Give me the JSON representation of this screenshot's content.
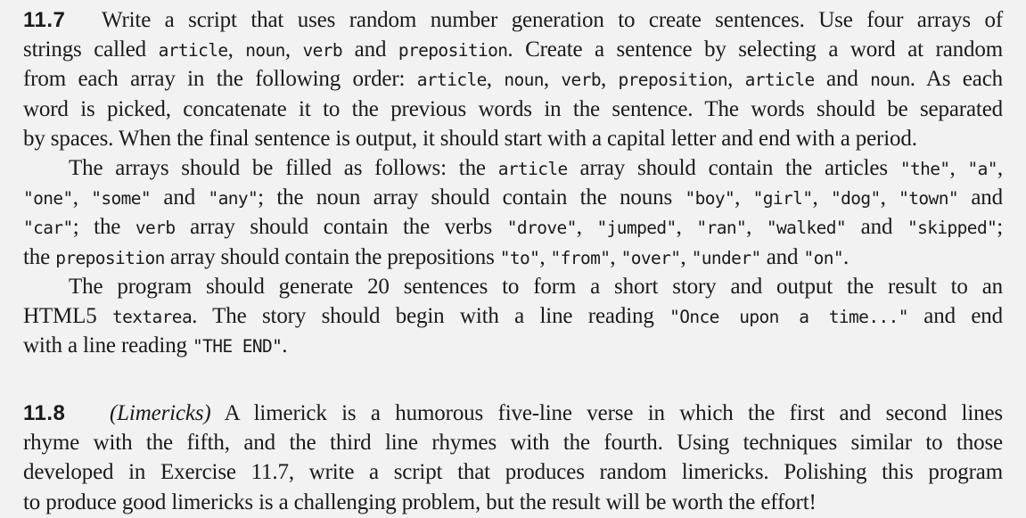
{
  "exercises": [
    {
      "number": "11.7",
      "lines": [
        {
          "indent": false,
          "last": false,
          "segments": [
            {
              "t": "num",
              "v": "11.7"
            },
            {
              "t": "text",
              "v": "Write a script that uses random number generation to create sentences. Use four arrays of"
            }
          ]
        },
        {
          "indent": false,
          "last": false,
          "segments": [
            {
              "t": "text",
              "v": "strings called "
            },
            {
              "t": "code",
              "v": "article"
            },
            {
              "t": "text",
              "v": ", "
            },
            {
              "t": "code",
              "v": "noun"
            },
            {
              "t": "text",
              "v": ", "
            },
            {
              "t": "code",
              "v": "verb"
            },
            {
              "t": "text",
              "v": " and "
            },
            {
              "t": "code",
              "v": "preposition"
            },
            {
              "t": "text",
              "v": ". Create a sentence by selecting a word at random"
            }
          ]
        },
        {
          "indent": false,
          "last": false,
          "segments": [
            {
              "t": "text",
              "v": "from each array in the following order: "
            },
            {
              "t": "code",
              "v": "article"
            },
            {
              "t": "text",
              "v": ", "
            },
            {
              "t": "code",
              "v": "noun"
            },
            {
              "t": "text",
              "v": ", "
            },
            {
              "t": "code",
              "v": "verb"
            },
            {
              "t": "text",
              "v": ", "
            },
            {
              "t": "code",
              "v": "preposition"
            },
            {
              "t": "text",
              "v": ", "
            },
            {
              "t": "code",
              "v": "article"
            },
            {
              "t": "text",
              "v": " and "
            },
            {
              "t": "code",
              "v": "noun"
            },
            {
              "t": "text",
              "v": ". As each"
            }
          ]
        },
        {
          "indent": false,
          "last": false,
          "segments": [
            {
              "t": "text",
              "v": "word is picked, concatenate it to the previous words in the sentence. The words should be separated"
            }
          ]
        },
        {
          "indent": false,
          "last": true,
          "segments": [
            {
              "t": "text",
              "v": "by spaces. When the final sentence is output, it should start with a capital letter and end with a period."
            }
          ]
        },
        {
          "indent": true,
          "last": false,
          "segments": [
            {
              "t": "text",
              "v": "The arrays should be filled as follows: the "
            },
            {
              "t": "code",
              "v": "article"
            },
            {
              "t": "text",
              "v": " array should contain the articles "
            },
            {
              "t": "code",
              "v": "\"the\""
            },
            {
              "t": "text",
              "v": ", "
            },
            {
              "t": "code",
              "v": "\"a\""
            },
            {
              "t": "text",
              "v": ","
            }
          ]
        },
        {
          "indent": false,
          "last": false,
          "segments": [
            {
              "t": "code",
              "v": "\"one\""
            },
            {
              "t": "text",
              "v": ", "
            },
            {
              "t": "code",
              "v": "\"some\""
            },
            {
              "t": "text",
              "v": " and "
            },
            {
              "t": "code",
              "v": "\"any\""
            },
            {
              "t": "text",
              "v": "; the noun array should contain the nouns "
            },
            {
              "t": "code",
              "v": "\"boy\""
            },
            {
              "t": "text",
              "v": ", "
            },
            {
              "t": "code",
              "v": "\"girl\""
            },
            {
              "t": "text",
              "v": ", "
            },
            {
              "t": "code",
              "v": "\"dog\""
            },
            {
              "t": "text",
              "v": ", "
            },
            {
              "t": "code",
              "v": "\"town\""
            },
            {
              "t": "text",
              "v": " and"
            }
          ]
        },
        {
          "indent": false,
          "last": false,
          "segments": [
            {
              "t": "code",
              "v": "\"car\""
            },
            {
              "t": "text",
              "v": "; the "
            },
            {
              "t": "code",
              "v": "verb"
            },
            {
              "t": "text",
              "v": " array should contain the verbs "
            },
            {
              "t": "code",
              "v": "\"drove\""
            },
            {
              "t": "text",
              "v": ", "
            },
            {
              "t": "code",
              "v": "\"jumped\""
            },
            {
              "t": "text",
              "v": ", "
            },
            {
              "t": "code",
              "v": "\"ran\""
            },
            {
              "t": "text",
              "v": ", "
            },
            {
              "t": "code",
              "v": "\"walked\""
            },
            {
              "t": "text",
              "v": " and "
            },
            {
              "t": "code",
              "v": "\"skipped\""
            },
            {
              "t": "text",
              "v": ";"
            }
          ]
        },
        {
          "indent": false,
          "last": true,
          "segments": [
            {
              "t": "text",
              "v": "the "
            },
            {
              "t": "code",
              "v": "preposition"
            },
            {
              "t": "text",
              "v": " array should contain the prepositions "
            },
            {
              "t": "code",
              "v": "\"to\""
            },
            {
              "t": "text",
              "v": ", "
            },
            {
              "t": "code",
              "v": "\"from\""
            },
            {
              "t": "text",
              "v": ", "
            },
            {
              "t": "code",
              "v": "\"over\""
            },
            {
              "t": "text",
              "v": ", "
            },
            {
              "t": "code",
              "v": "\"under\""
            },
            {
              "t": "text",
              "v": " and "
            },
            {
              "t": "code",
              "v": "\"on\""
            },
            {
              "t": "text",
              "v": "."
            }
          ]
        },
        {
          "indent": true,
          "last": false,
          "segments": [
            {
              "t": "text",
              "v": "The program should generate 20 sentences to form a short story and output the result to an"
            }
          ]
        },
        {
          "indent": false,
          "last": false,
          "segments": [
            {
              "t": "text",
              "v": "HTML5 "
            },
            {
              "t": "code",
              "v": "textarea"
            },
            {
              "t": "text",
              "v": ". The story should begin with a line reading "
            },
            {
              "t": "code",
              "v": "\"Once upon a time...\""
            },
            {
              "t": "text",
              "v": " and end"
            }
          ]
        },
        {
          "indent": false,
          "last": true,
          "segments": [
            {
              "t": "text",
              "v": "with a line reading "
            },
            {
              "t": "code",
              "v": "\"THE END\""
            },
            {
              "t": "text",
              "v": "."
            }
          ]
        }
      ]
    },
    {
      "number": "11.8",
      "lines": [
        {
          "indent": false,
          "last": false,
          "segments": [
            {
              "t": "num",
              "v": "11.8"
            },
            {
              "t": "ital",
              "v": "(Limericks)"
            },
            {
              "t": "text",
              "v": " A limerick is a humorous five-line verse in which the first and second lines"
            }
          ]
        },
        {
          "indent": false,
          "last": false,
          "segments": [
            {
              "t": "text",
              "v": "rhyme with the fifth, and the third line rhymes with the fourth. Using techniques similar to those"
            }
          ]
        },
        {
          "indent": false,
          "last": false,
          "segments": [
            {
              "t": "text",
              "v": "developed in Exercise 11.7, write a script that produces random limericks. Polishing this program"
            }
          ]
        },
        {
          "indent": false,
          "last": true,
          "segments": [
            {
              "t": "text",
              "v": "to produce good limericks is a challenging problem, but the result will be worth the effort!"
            }
          ]
        }
      ]
    }
  ]
}
